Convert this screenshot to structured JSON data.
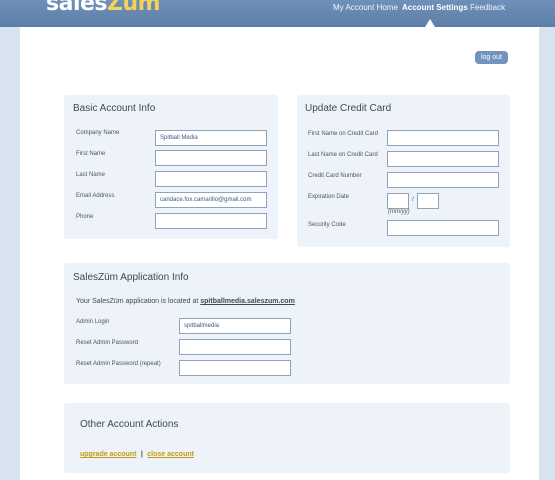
{
  "header": {
    "logo": {
      "main": "sales",
      "accent": "Züm"
    },
    "nav": {
      "home": "My Account Home",
      "settings": "Account Settings",
      "feedback": "Feedback"
    }
  },
  "logout_label": "log out",
  "basic": {
    "title": "Basic Account Info",
    "company_label": "Company Name",
    "company_value": "Spitball Media",
    "first_label": "First Name",
    "first_value": "",
    "last_label": "Last Name",
    "last_value": "",
    "email_label": "Email Address",
    "email_value": "candace.fox.camarillo@gmail.com",
    "phone_label": "Phone",
    "phone_value": ""
  },
  "card": {
    "title": "Update Credit Card",
    "first_label": "First Name on Credit Card",
    "last_label": "Last Name on Credit Card",
    "number_label": "Credit Card Number",
    "exp_label": "Expiration Date",
    "exp_sep": "/",
    "exp_hint": "(mm/yy)",
    "security_label": "Security Code"
  },
  "app": {
    "title": "SalesZüm Application Info",
    "location_text": "Your SalesZüm application is located at",
    "location_url": "spitballmedia.saleszum.com",
    "login_label": "Admin Login",
    "login_value": "spitballmedia",
    "reset_label": "Reset Admin Password",
    "repeat_label": "Reset Admin Password (repeat)"
  },
  "other": {
    "title": "Other Account Actions",
    "upgrade": "upgrade account",
    "separator": "|",
    "close": "close account"
  }
}
